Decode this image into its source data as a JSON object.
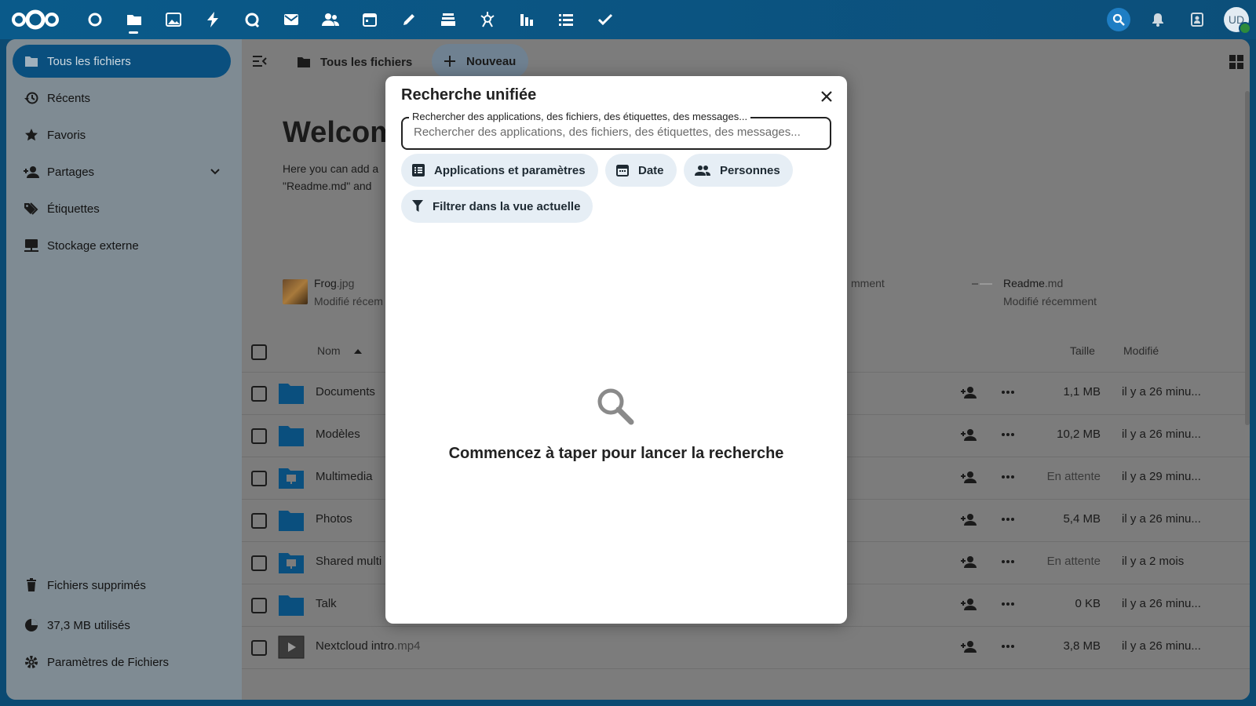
{
  "topbar": {
    "apps": [
      "dashboard-icon",
      "files-icon",
      "photos-icon",
      "activity-icon",
      "talk-icon",
      "mail-icon",
      "contacts-icon",
      "calendar-icon",
      "notes-icon",
      "deck-icon",
      "maps-icon",
      "analytics-icon",
      "tasks-icon",
      "checklist-icon"
    ],
    "avatar_initials": "UD"
  },
  "sidebar": {
    "items": [
      {
        "label": "Tous les fichiers"
      },
      {
        "label": "Récents"
      },
      {
        "label": "Favoris"
      },
      {
        "label": "Partages"
      },
      {
        "label": "Étiquettes"
      },
      {
        "label": "Stockage externe"
      }
    ],
    "trash": "Fichiers supprimés",
    "quota": "37,3 MB utilisés",
    "settings": "Paramètres de Fichiers"
  },
  "main": {
    "breadcrumb": "Tous les fichiers",
    "new_button": "Nouveau",
    "welcome_title": "Welcom",
    "welcome_text_1": "Here you can add a",
    "welcome_text_2": "\"Readme.md\" and",
    "recent": [
      {
        "name": "Frog",
        "ext": ".jpg",
        "sub": "Modifié récem"
      },
      {
        "name": "",
        "ext": "",
        "sub": "mment"
      },
      {
        "name": "Readme",
        "ext": ".md",
        "sub": "Modifié récemment"
      }
    ],
    "columns": {
      "name": "Nom",
      "size": "Taille",
      "modified": "Modifié"
    },
    "rows": [
      {
        "name": "Documents",
        "ext": "",
        "size": "1,1 MB",
        "modified": "il y a 26 minu..."
      },
      {
        "name": "Modèles",
        "ext": "",
        "size": "10,2 MB",
        "modified": "il y a 26 minu..."
      },
      {
        "name": "Multimedia",
        "ext": "",
        "size": "En attente",
        "modified": "il y a 29 minu..."
      },
      {
        "name": "Photos",
        "ext": "",
        "size": "5,4 MB",
        "modified": "il y a 26 minu..."
      },
      {
        "name": "Shared multi",
        "ext": "",
        "size": "En attente",
        "modified": "il y a 2 mois"
      },
      {
        "name": "Talk",
        "ext": "",
        "size": "0 KB",
        "modified": "il y a 26 minu..."
      },
      {
        "name": "Nextcloud intro",
        "ext": ".mp4",
        "size": "3,8 MB",
        "modified": "il y a 26 minu..."
      }
    ]
  },
  "dialog": {
    "title": "Recherche unifiée",
    "search_label": "Rechercher des applications, des fichiers, des étiquettes, des messages...",
    "search_placeholder": "Rechercher des applications, des fichiers, des étiquettes, des messages...",
    "search_value": "",
    "filters": {
      "apps": "Applications et paramètres",
      "date": "Date",
      "people": "Personnes",
      "current_view": "Filtrer dans la vue actuelle"
    },
    "empty_message": "Commencez à taper pour lancer la recherche"
  },
  "colors": {
    "topbar": "#0a5a8a",
    "primary": "#0a4f7e",
    "search_accent": "#1f7ec4",
    "chip_bg": "#e6eef5"
  }
}
